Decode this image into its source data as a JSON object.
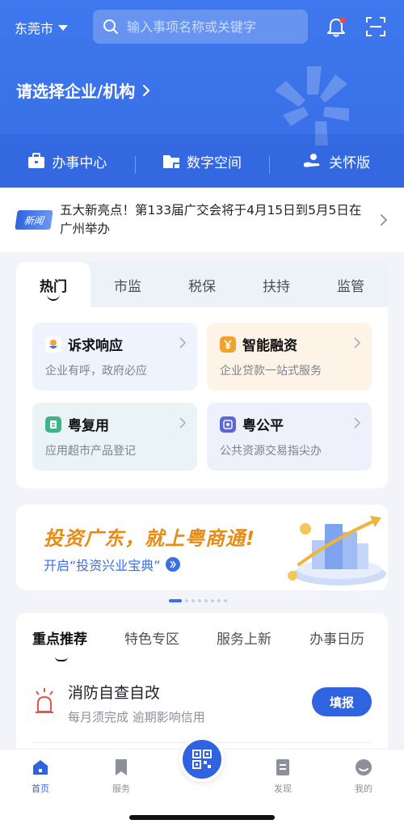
{
  "header": {
    "city": "东莞市",
    "search_placeholder": "输入事项名称或关键字",
    "enterprise_prompt": "请选择企业/机构",
    "quick_actions": [
      {
        "label": "办事中心",
        "icon": "briefcase-icon"
      },
      {
        "label": "数字空间",
        "icon": "folder-icon"
      },
      {
        "label": "关怀版",
        "icon": "care-hand-icon"
      }
    ]
  },
  "news": {
    "badge": "新闻",
    "text": "五大新亮点！第133届广交会将于4月15日到5月5日在广州举办"
  },
  "services": {
    "tabs": [
      "热门",
      "市监",
      "税保",
      "扶持",
      "监管"
    ],
    "active_tab": 0,
    "tiles": [
      {
        "title": "诉求响应",
        "subtitle": "企业有呼，政府必应",
        "icon": "flower-icon",
        "bg": "#eef3fd",
        "icon_color": "#3a6fe5"
      },
      {
        "title": "智能融资",
        "subtitle": "企业贷款一站式服务",
        "icon": "yuan-icon",
        "bg": "#fdf3e6",
        "icon_color": "#f0a22e"
      },
      {
        "title": "粤复用",
        "subtitle": "应用超市产品登记",
        "icon": "document-icon",
        "bg": "#eaf4f7",
        "icon_color": "#3fb38a"
      },
      {
        "title": "粤公平",
        "subtitle": "公共资源交易指尖办",
        "icon": "scale-icon",
        "bg": "#eef0fb",
        "icon_color": "#5b67d8"
      }
    ]
  },
  "banner": {
    "title": "投资广东，就上粤商通!",
    "link": "开启“投资兴业宝典”",
    "pagination_total": 8,
    "pagination_active": 0
  },
  "recommend": {
    "tabs": [
      "重点推荐",
      "特色专区",
      "服务上新",
      "办事日历"
    ],
    "active_tab": 0,
    "task_title": "消防自查自改",
    "task_subtitle": "每月须完成 逾期影响信用",
    "task_button": "填报"
  },
  "tabbar": {
    "items": [
      {
        "label": "首页",
        "icon": "home-icon",
        "active": true
      },
      {
        "label": "服务",
        "icon": "bookmark-icon",
        "active": false
      },
      {
        "label": "发现",
        "icon": "discover-icon",
        "active": false
      },
      {
        "label": "我的",
        "icon": "profile-icon",
        "active": false
      }
    ],
    "center_icon": "qr-code-icon"
  },
  "colors": {
    "brand_blue": "#3a71e8",
    "button_blue": "#2f63df",
    "banner_orange": "#e88b17"
  }
}
